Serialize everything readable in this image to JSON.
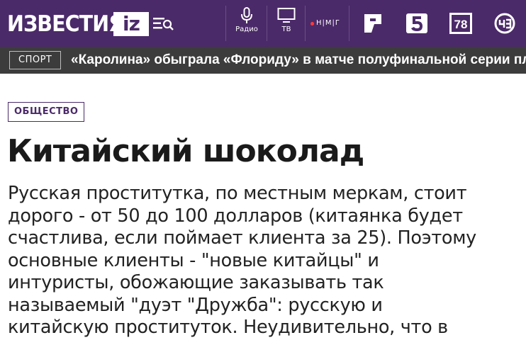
{
  "header": {
    "logo_text": "ИЗВЕСТИЯ",
    "logo_badge": "iz",
    "radio_label": "Радио",
    "tv_label": "ТВ",
    "nmg_label": "Н|М|Г",
    "channels": [
      {
        "icon": "ren-tv-icon"
      },
      {
        "icon": "channel-5-icon"
      },
      {
        "icon": "channel-78-icon",
        "text": "78"
      },
      {
        "icon": "che-icon"
      }
    ]
  },
  "ticker": {
    "tag": "СПОРТ",
    "headline": "«Каролина» обыграла «Флориду» в матче полуфинальной серии плей-офф"
  },
  "article": {
    "rubric": "ОБЩЕСТВО",
    "title": "Китайский шоколад",
    "lines": [
      "Русская проститутка, по местным меркам, стоит",
      "дорого - от 50 до 100 долларов (китаянка будет",
      "счастлива, если поймает клиента за 25). Поэтому",
      "основные клиенты - \"новые китайцы\" и",
      "интуристы, обожающие заказывать так",
      "называемый \"дуэт \"Дружба\": русскую и",
      "китайскую проституток. Неудивительно, что в"
    ]
  },
  "colors": {
    "header_bg": "#4b2a69",
    "ticker_bg": "#3c3c3c",
    "accent": "#4b2a69"
  }
}
